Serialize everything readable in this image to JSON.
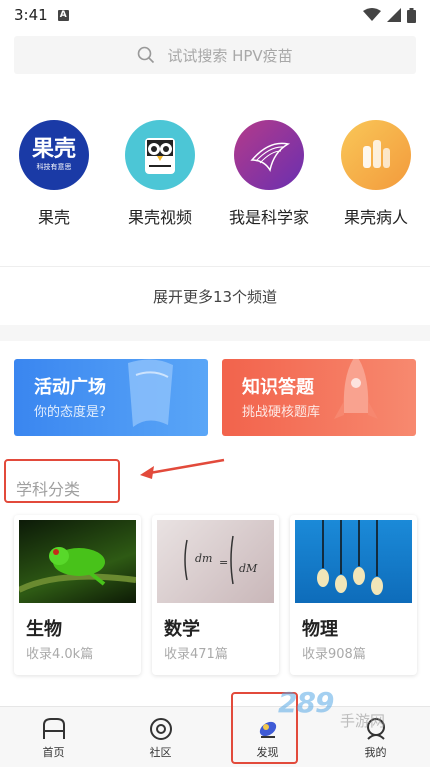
{
  "status_bar": {
    "time": "3:41",
    "badge": "A"
  },
  "search": {
    "placeholder": "试试搜索 HPV疫苗"
  },
  "channels": [
    {
      "label": "果壳",
      "logo_text": "果壳",
      "logo_sub": "科技有意思"
    },
    {
      "label": "果壳视频"
    },
    {
      "label": "我是科学家"
    },
    {
      "label": "果壳病人"
    }
  ],
  "more_channels": "展开更多13个频道",
  "banners": [
    {
      "title": "活动广场",
      "subtitle": "你的态度是?",
      "color": "#3d8ef0"
    },
    {
      "title": "知识答题",
      "subtitle": "挑战硬核题库",
      "color": "#f36b52"
    }
  ],
  "section_title": "学科分类",
  "subjects": [
    {
      "name": "生物",
      "count": "收录4.0k篇"
    },
    {
      "name": "数学",
      "count": "收录471篇"
    },
    {
      "name": "物理",
      "count": "收录908篇"
    }
  ],
  "tabs": [
    {
      "label": "首页",
      "icon": "home-icon"
    },
    {
      "label": "社区",
      "icon": "community-icon"
    },
    {
      "label": "发现",
      "icon": "discover-icon",
      "active": true
    },
    {
      "label": "我的",
      "icon": "profile-icon"
    }
  ],
  "watermark": {
    "main": "289",
    "site": "手游网"
  },
  "colors": {
    "annotation": "#e24a3b",
    "activity": "#3d8ef0",
    "quiz": "#f36b52"
  }
}
